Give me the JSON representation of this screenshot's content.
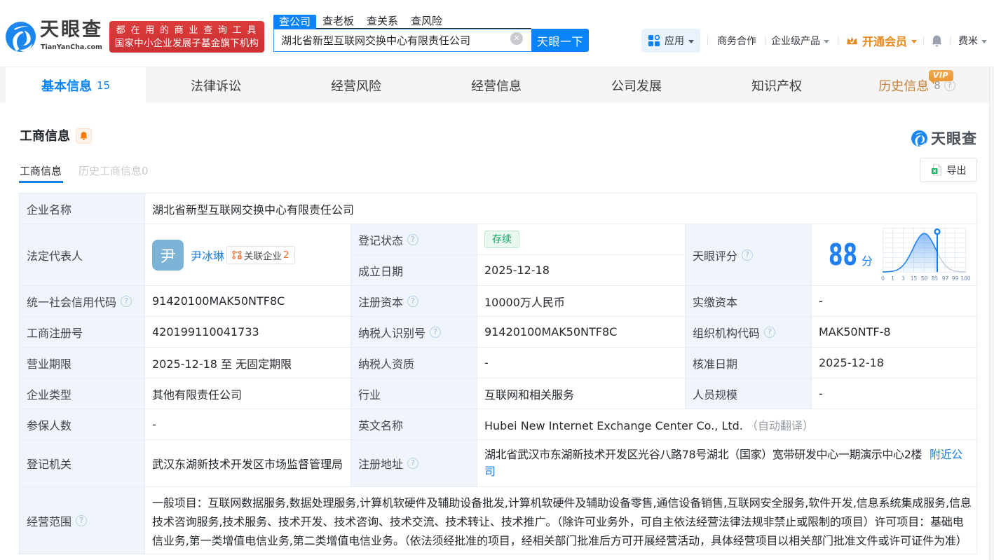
{
  "brand": {
    "name": "天眼查",
    "domain": "TianYanCha.com",
    "slogan_line1": "都 在 用 的 商 业 查 询 工 具",
    "slogan_line2": "国家中小企业发展子基金旗下机构"
  },
  "search": {
    "tabs": [
      {
        "label": "查公司"
      },
      {
        "label": "查老板"
      },
      {
        "label": "查关系"
      },
      {
        "label": "查风险"
      }
    ],
    "value": "湖北省新型互联网交换中心有限责任公司",
    "button": "天眼一下"
  },
  "topnav": {
    "apps": "应用",
    "business": "商务合作",
    "enterprise": "企业级产品",
    "vip": "开通会员",
    "user": "费米"
  },
  "nav_tabs": [
    {
      "label": "基本信息",
      "count": "15"
    },
    {
      "label": "法律诉讼"
    },
    {
      "label": "经营风险"
    },
    {
      "label": "经营信息"
    },
    {
      "label": "公司发展"
    },
    {
      "label": "知识产权"
    },
    {
      "label": "历史信息",
      "count": "8",
      "badge": "VIP"
    }
  ],
  "section": {
    "title": "工商信息",
    "subtab_current": "工商信息",
    "subtab_history": "历史工商信息0",
    "export_label": "导出",
    "watermark": "天眼查"
  },
  "fields": {
    "company_name": {
      "label": "企业名称",
      "value": "湖北省新型互联网交换中心有限责任公司"
    },
    "legal_rep": {
      "label": "法定代表人",
      "name": "尹冰琳",
      "avatar": "尹",
      "related_label": "关联企业",
      "related_count": "2"
    },
    "reg_status": {
      "label": "登记状态",
      "value": "存续"
    },
    "establish_date": {
      "label": "成立日期",
      "value": "2025-12-18"
    },
    "score": {
      "label": "天眼评分",
      "value": "88",
      "unit": "分",
      "axis": [
        "0",
        "1",
        "3",
        "15",
        "50",
        "85",
        "97",
        "99",
        "100"
      ]
    },
    "credit_code": {
      "label": "统一社会信用代码",
      "value": "91420100MAK50NTF8C"
    },
    "reg_capital": {
      "label": "注册资本",
      "value": "10000万人民币"
    },
    "paid_capital": {
      "label": "实缴资本",
      "value": "-"
    },
    "reg_number": {
      "label": "工商注册号",
      "value": "420199110041733"
    },
    "taxpayer_id": {
      "label": "纳税人识别号",
      "value": "91420100MAK50NTF8C"
    },
    "org_code": {
      "label": "组织机构代码",
      "value": "MAK50NTF-8"
    },
    "business_term": {
      "label": "营业期限",
      "value": "2025-12-18 至 无固定期限"
    },
    "taxpayer_quality": {
      "label": "纳税人资质",
      "value": "-"
    },
    "approval_date": {
      "label": "核准日期",
      "value": "2025-12-18"
    },
    "company_type": {
      "label": "企业类型",
      "value": "其他有限责任公司"
    },
    "industry": {
      "label": "行业",
      "value": "互联网和相关服务"
    },
    "staff_size": {
      "label": "人员规模",
      "value": "-"
    },
    "insured_count": {
      "label": "参保人数",
      "value": "-"
    },
    "english_name": {
      "label": "英文名称",
      "value": "Hubei New Internet Exchange Center Co., Ltd.",
      "note": "（自动翻译）"
    },
    "reg_authority": {
      "label": "登记机关",
      "value": "武汉东湖新技术开发区市场监督管理局"
    },
    "reg_address": {
      "label": "注册地址",
      "value": "湖北省武汉市东湖新技术开发区光谷八路78号湖北（国家）宽带研发中心一期演示中心2楼",
      "link": "附近公司"
    },
    "business_scope": {
      "label": "经营范围",
      "value": "一般项目：互联网数据服务,数据处理服务,计算机软硬件及辅助设备批发,计算机软硬件及辅助设备零售,通信设备销售,互联网安全服务,软件开发,信息系统集成服务,信息技术咨询服务,技术服务、技术开发、技术咨询、技术交流、技术转让、技术推广。（除许可业务外，可自主依法经营法律法规非禁止或限制的项目）许可项目：基础电信业务,第一类增值电信业务,第二类增值电信业务。（依法须经批准的项目，经相关部门批准后方可开展经营活动，具体经营项目以相关部门批准文件或许可证件为准）"
    }
  }
}
